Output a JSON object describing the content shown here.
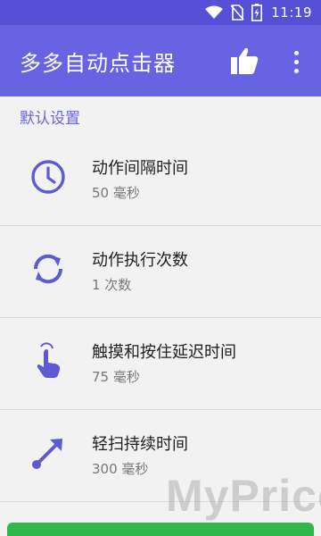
{
  "status_bar": {
    "time": "11:19",
    "icons": [
      "wifi-icon",
      "no-sim-icon",
      "battery-charging-icon"
    ]
  },
  "app_bar": {
    "title": "多多自动点击器",
    "actions": [
      "thumbs-up-icon",
      "more-vert-icon"
    ]
  },
  "section": {
    "title": "默认设置"
  },
  "settings": [
    {
      "icon": "clock-icon",
      "title": "动作间隔时间",
      "value": "50 毫秒"
    },
    {
      "icon": "repeat-icon",
      "title": "动作执行次数",
      "value": "1 次数"
    },
    {
      "icon": "touch-icon",
      "title": "触摸和按住延迟时间",
      "value": "75 毫秒"
    },
    {
      "icon": "swipe-arrow-icon",
      "title": "轻扫持续时间",
      "value": "300 毫秒"
    }
  ],
  "watermark": "MyPrice",
  "colors": {
    "status_bar": "#5650d6",
    "app_bar": "#6763e3",
    "accent": "#6a66d8",
    "bottom_button": "#2fb84a"
  }
}
